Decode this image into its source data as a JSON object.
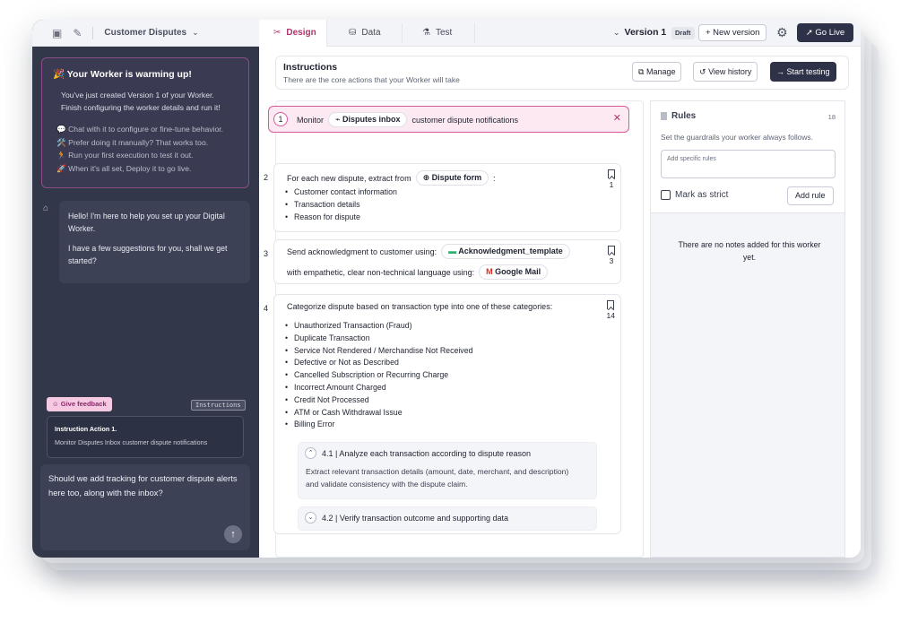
{
  "header": {
    "project_name": "Customer Disputes",
    "tabs": [
      {
        "label": "Design",
        "active": true
      },
      {
        "label": "Data",
        "active": false
      },
      {
        "label": "Test",
        "active": false
      }
    ],
    "version_label": "Version 1",
    "draft_badge": "Draft",
    "new_version_label": "+ New version",
    "go_live_label": "Go Live"
  },
  "left_panel": {
    "warmup_title": "🎉 Your Worker is warming up!",
    "warmup_body_1": "You've just created Version 1 of your Worker.",
    "warmup_body_2": "Finish configuring the worker details and run it!",
    "warmup_tips": [
      "💬 Chat with it to configure or fine-tune behavior.",
      "🛠️ Prefer doing it manually? That works too.",
      "🏃 Run your first execution to test it out.",
      "🚀 When it's all set, Deploy it to go live."
    ],
    "assistant_message_1": "Hello! I'm here to help you set up your Digital Worker.",
    "assistant_message_2": "I have a few suggestions for you, shall we get started?",
    "feedback_label": "Give feedback",
    "instructions_tag": "Instructions",
    "action_card_title": "Instruction Action 1.",
    "action_card_desc": "Monitor Disputes Inbox customer dispute notifications",
    "composer_text": "Should we add tracking for customer dispute alerts here too, along with the inbox?"
  },
  "instructions": {
    "title": "Instructions",
    "subtitle": "There are the core actions that your Worker will take",
    "manage_label": "Manage",
    "history_label": "View history",
    "start_testing_label": "Start testing"
  },
  "steps": {
    "s1": {
      "num": "1",
      "prefix": "Monitor",
      "chip": "Disputes inbox",
      "suffix": "customer dispute notifications"
    },
    "s2": {
      "num": "2",
      "prefix": "For each new dispute, extract from",
      "chip": "Dispute form",
      "suffix": ":",
      "bookmarks": "1",
      "items": [
        "Customer contact information",
        "Transaction details",
        "Reason for dispute"
      ]
    },
    "s3": {
      "num": "3",
      "prefix": "Send acknowledgment to customer using:",
      "chip": "Acknowledgment_template",
      "line2": "with empathetic, clear non-technical language using:",
      "chip2": "Google Mail",
      "bookmarks": "3"
    },
    "s4": {
      "num": "4",
      "prefix": "Categorize dispute based on transaction type into one of these categories:",
      "bookmarks": "14",
      "items": [
        "Unauthorized Transaction (Fraud)",
        "Duplicate Transaction",
        "Service Not Rendered / Merchandise Not Received",
        "Defective or Not as Described",
        "Cancelled Subscription or Recurring Charge",
        "Incorrect Amount Charged",
        "Credit Not Processed",
        "ATM or Cash Withdrawal Issue",
        "Billing Error"
      ],
      "sub1_title": "4.1 | Analyze each transaction according to dispute reason",
      "sub1_body": "Extract relevant transaction details (amount, date, merchant, and description) and validate consistency with the dispute claim.",
      "sub2_title": "4.2 | Verify transaction outcome and supporting data"
    }
  },
  "rules": {
    "title": "Rules",
    "count": "18",
    "description": "Set the guardrails your worker always follows.",
    "input_placeholder": "Add specific rules",
    "strict_label": "Mark as strict",
    "add_rule_label": "Add rule",
    "empty_text": "There are no notes added for this worker yet."
  },
  "colors": {
    "accent": "#b1336e",
    "dark_button": "#2e3248",
    "left_panel_bg": "#33374a",
    "highlight_bg": "#fce9f2"
  }
}
